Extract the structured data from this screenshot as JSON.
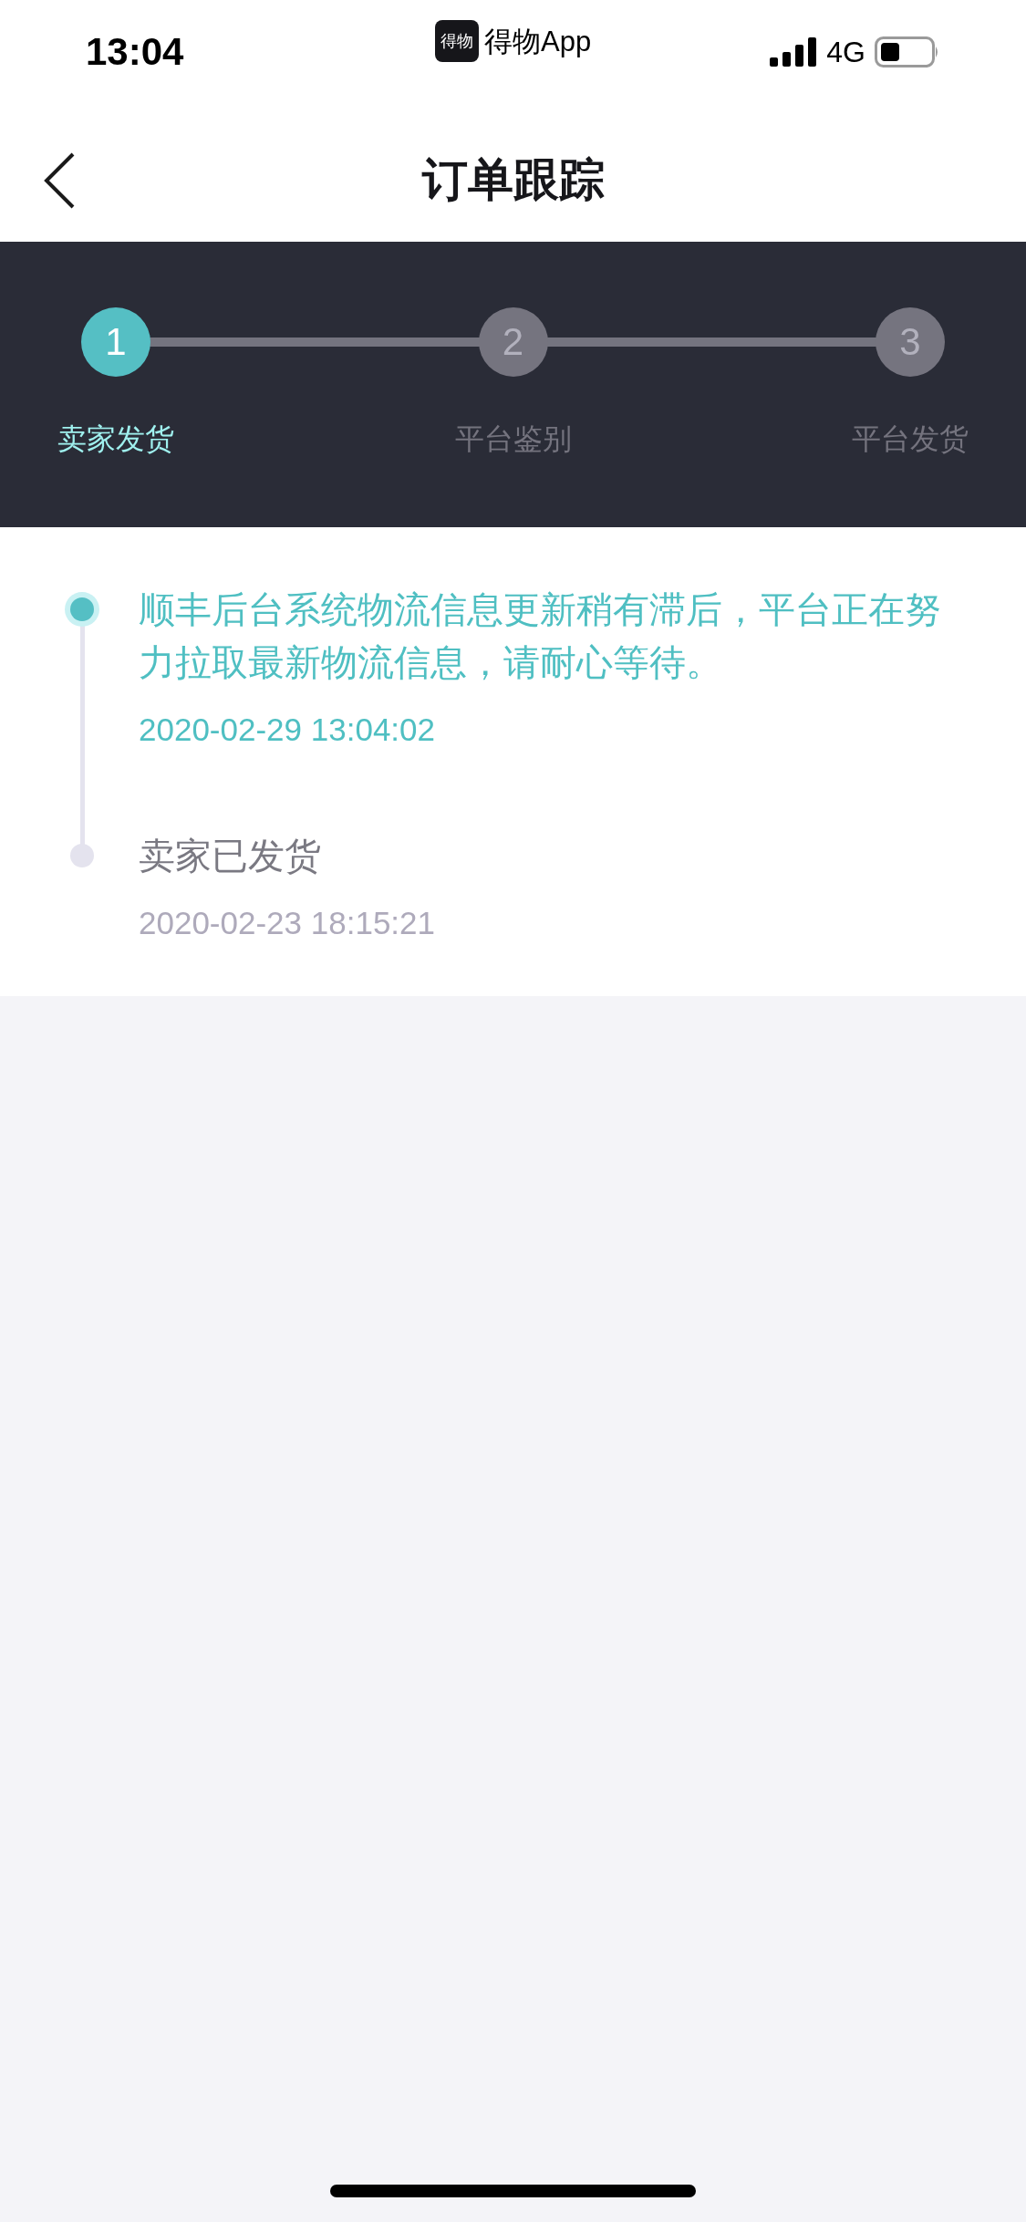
{
  "status_bar": {
    "time": "13:04",
    "app_logo_text": "得物",
    "app_name": "得物App",
    "network": "4G"
  },
  "nav": {
    "title": "订单跟踪"
  },
  "steps": [
    {
      "number": "1",
      "label": "卖家发货",
      "selected": true
    },
    {
      "number": "2",
      "label": "平台鉴别",
      "selected": false
    },
    {
      "number": "3",
      "label": "平台发货",
      "selected": false
    }
  ],
  "events": [
    {
      "text": "顺丰后台系统物流信息更新稍有滞后，平台正在努力拉取最新物流信息，请耐心等待。",
      "time": "2020-02-29 13:04:02",
      "active": true
    },
    {
      "text": "卖家已发货",
      "time": "2020-02-23 18:15:21",
      "active": false
    }
  ]
}
